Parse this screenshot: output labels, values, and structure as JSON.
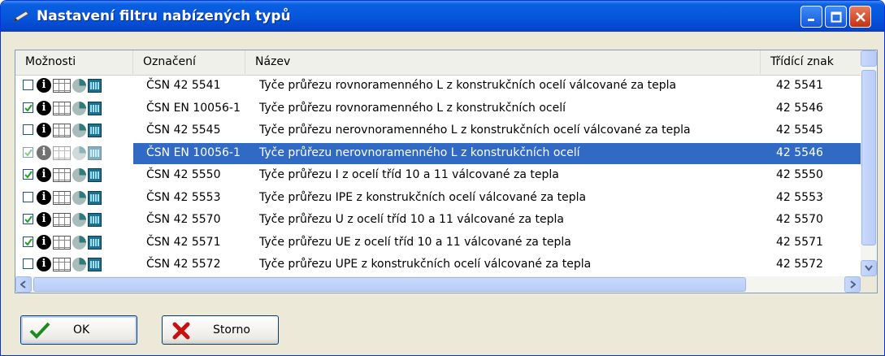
{
  "window": {
    "title": "Nastavení filtru nabízených typů"
  },
  "columns": {
    "options": "Možnosti",
    "code": "Označení",
    "name": "Název",
    "sort": "Třídící znak"
  },
  "rows": [
    {
      "checked": false,
      "selected": false,
      "code": "ČSN 42 5541",
      "name": "Tyče průřezu rovnoramenného L z konstrukčních ocelí válcované za tepla",
      "sort": "42 5541"
    },
    {
      "checked": true,
      "selected": false,
      "code": "ČSN EN 10056-1",
      "name": "Tyče průřezu rovnoramenného L z konstrukčních ocelí",
      "sort": "42 5546"
    },
    {
      "checked": false,
      "selected": false,
      "code": "ČSN 42 5545",
      "name": "Tyče průřezu nerovnoramenného L z konstrukčních ocelí válcované za tepla",
      "sort": "42 5545"
    },
    {
      "checked": true,
      "selected": true,
      "code": "ČSN EN 10056-1",
      "name": "Tyče průřezu nerovnoramenného L z konstrukčních ocelí",
      "sort": "42 5546"
    },
    {
      "checked": true,
      "selected": false,
      "code": "ČSN 42 5550",
      "name": "Tyče průřezu I z ocelí tříd 10 a 11 válcované za tepla",
      "sort": "42 5550"
    },
    {
      "checked": false,
      "selected": false,
      "code": "ČSN 42 5553",
      "name": "Tyče průřezu IPE z konstrukčních ocelí válcované za tepla",
      "sort": "42 5553"
    },
    {
      "checked": true,
      "selected": false,
      "code": "ČSN 42 5570",
      "name": "Tyče průřezu U z ocelí tříd 10 a 11 válcované za tepla",
      "sort": "42 5570"
    },
    {
      "checked": true,
      "selected": false,
      "code": "ČSN 42 5571",
      "name": "Tyče průřezu UE z ocelí tříd 10 a 11 válcované za tepla",
      "sort": "42 5571"
    },
    {
      "checked": false,
      "selected": false,
      "code": "ČSN 42 5572",
      "name": "Tyče průřezu UPE z konstrukčních ocelí válcované za tepla",
      "sort": "42 5572"
    }
  ],
  "buttons": {
    "ok": "OK",
    "cancel": "Storno"
  },
  "icons": [
    "info-icon",
    "table-icon",
    "chart-icon",
    "calculator-icon"
  ],
  "colors": {
    "titlebar": "#0558dc",
    "selection": "#316ac5",
    "window_bg": "#ece9d8"
  }
}
